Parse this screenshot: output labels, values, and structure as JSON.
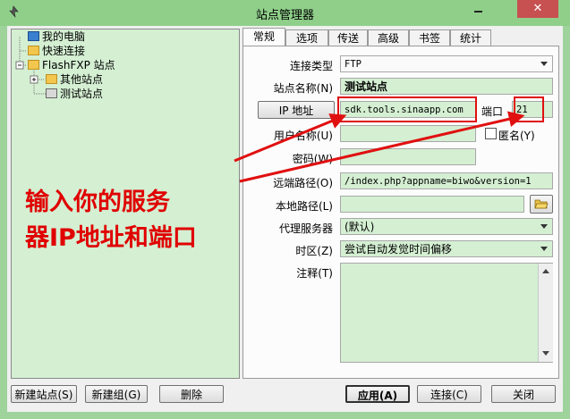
{
  "window": {
    "title": "站点管理器",
    "close_label": "✕"
  },
  "tree": {
    "items": [
      {
        "label": "我的电脑",
        "icon": "computer-icon"
      },
      {
        "label": "快速连接",
        "icon": "folder-icon"
      },
      {
        "label": "FlashFXP 站点",
        "icon": "folder-icon"
      },
      {
        "label": "其他站点",
        "icon": "folder-icon"
      },
      {
        "label": "测试站点",
        "icon": "server-icon"
      }
    ]
  },
  "tabs": [
    "常规",
    "选项",
    "传送",
    "高级",
    "书签",
    "统计"
  ],
  "form": {
    "conn_type_label": "连接类型",
    "conn_type_value": "FTP",
    "site_name_label": "站点名称(N)",
    "site_name_value": "测试站点",
    "ip_button": "IP 地址",
    "ip_value": "sdk.tools.sinaapp.com",
    "port_label": "端口",
    "port_value": "21",
    "user_label": "用户名称(U)",
    "user_value": "",
    "anon_label": "匿名(Y)",
    "password_label": "密码(W)",
    "password_value": "",
    "remote_label": "远端路径(O)",
    "remote_value": "/index.php?appname=biwo&version=1",
    "local_label": "本地路径(L)",
    "local_value": "",
    "proxy_label": "代理服务器",
    "proxy_value": "(默认)",
    "tz_label": "时区(Z)",
    "tz_value": "尝试自动发觉时间偏移",
    "notes_label": "注释(T)",
    "notes_value": ""
  },
  "buttons": {
    "new_site": "新建站点(S)",
    "new_group": "新建组(G)",
    "delete": "删除",
    "apply": "应用(A)",
    "connect": "连接(C)",
    "close": "关闭"
  },
  "annotation": {
    "line1": "输入你的服务",
    "line2": "器IP地址和端口"
  },
  "colors": {
    "field_bg": "#d4efd2",
    "window_frame": "#9ed39b",
    "highlight_red": "#e01010"
  }
}
